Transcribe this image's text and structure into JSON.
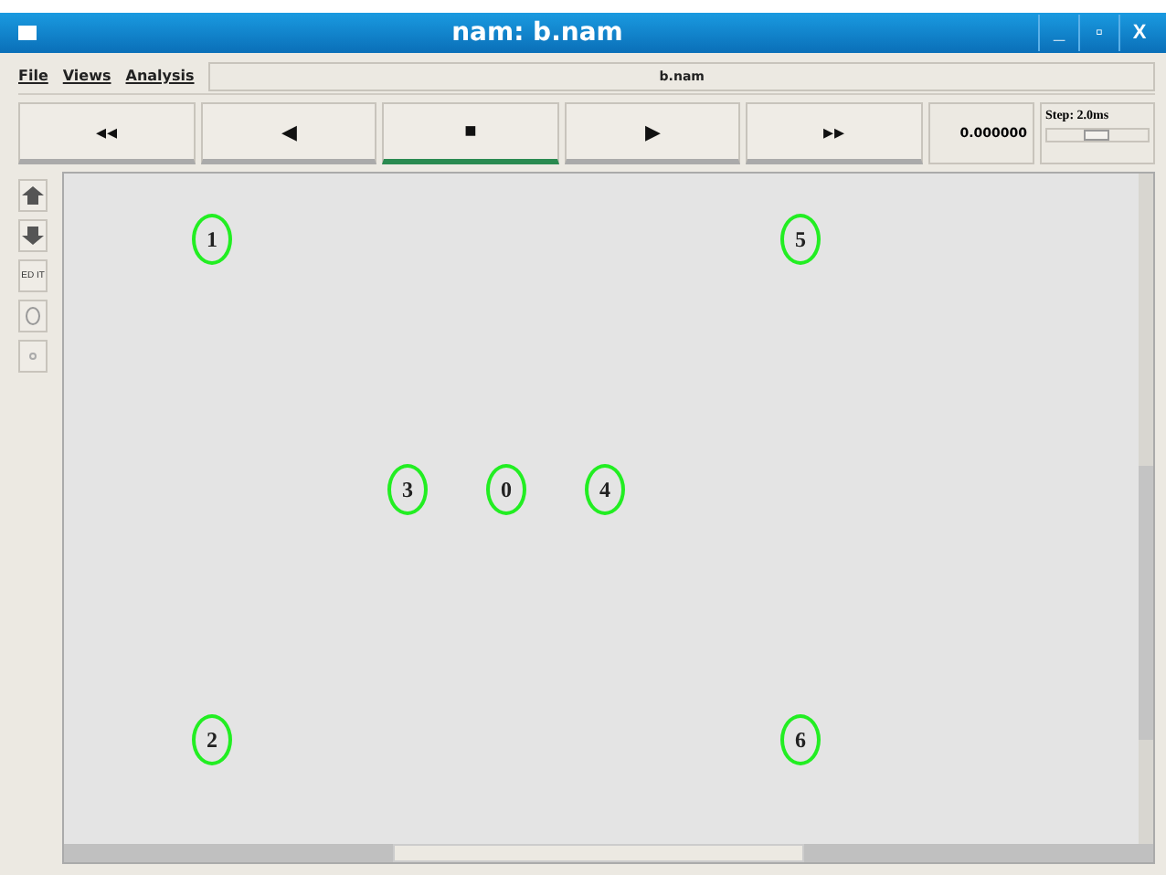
{
  "window": {
    "title": "nam: b.nam",
    "controls": [
      "_",
      "▫",
      "X"
    ]
  },
  "menu": [
    "File",
    "Views",
    "Analysis"
  ],
  "file_name": "b.nam",
  "playback": [
    {
      "label": "◂◂",
      "selected": false
    },
    {
      "label": "◀",
      "selected": false
    },
    {
      "label": "■",
      "selected": true
    },
    {
      "label": "▶",
      "selected": false
    },
    {
      "label": "▸▸",
      "selected": false
    }
  ],
  "time": "0.000000",
  "step": {
    "label": "Step: 2.0ms",
    "level": 0.5
  },
  "tools": [
    {
      "kind": "zoom-in"
    },
    {
      "kind": "zoom-out"
    },
    {
      "kind": "edit",
      "label": "ED IT"
    },
    {
      "kind": "circle"
    },
    {
      "kind": "dot"
    }
  ],
  "nodes": [
    "1",
    "5",
    "3",
    "0",
    "4",
    "2",
    "6"
  ]
}
